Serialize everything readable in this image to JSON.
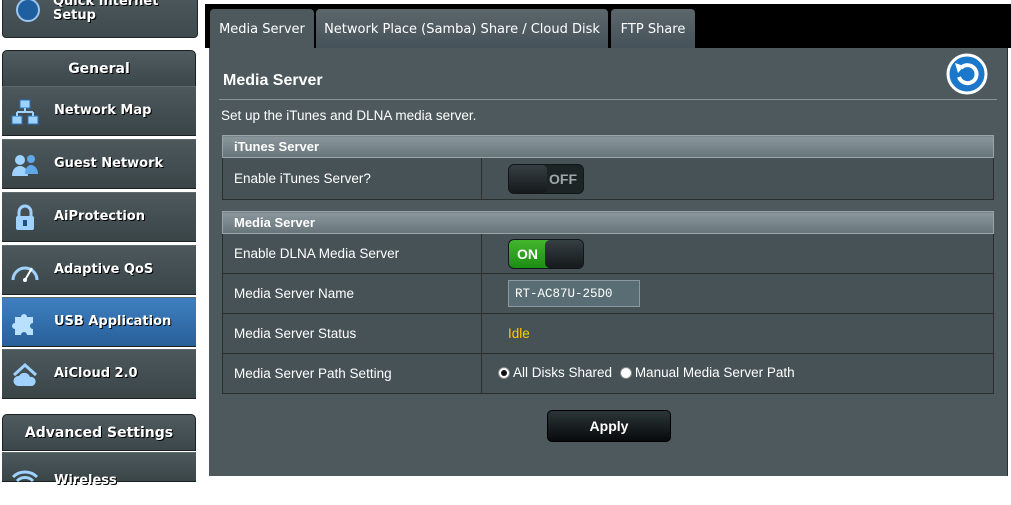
{
  "sidebar": {
    "quick_setup_line1": "Quick Internet",
    "quick_setup_line2": "Setup",
    "general_header": "General",
    "items": [
      {
        "label": "Network Map",
        "icon": "network-map-icon"
      },
      {
        "label": "Guest Network",
        "icon": "guest-network-icon"
      },
      {
        "label": "AiProtection",
        "icon": "lock-icon"
      },
      {
        "label": "Adaptive QoS",
        "icon": "speedometer-icon"
      },
      {
        "label": "USB Application",
        "icon": "puzzle-icon",
        "active": true
      },
      {
        "label": "AiCloud 2.0",
        "icon": "cloud-home-icon"
      }
    ],
    "advanced_header": "Advanced Settings",
    "partial_item": "Wireless"
  },
  "tabs": [
    {
      "label": "Media Server",
      "selected": true
    },
    {
      "label": "Network Place (Samba) Share / Cloud Disk"
    },
    {
      "label": "FTP Share"
    }
  ],
  "main": {
    "title": "Media Server",
    "description": "Set up the iTunes and DLNA media server.",
    "itunes_section": {
      "header": "iTunes Server",
      "enable_label": "Enable iTunes Server?",
      "enable_state": "OFF"
    },
    "media_section": {
      "header": "Media Server",
      "dlna_label": "Enable DLNA Media Server",
      "dlna_state": "ON",
      "name_label": "Media Server Name",
      "name_value": "RT-AC87U-25D0",
      "status_label": "Media Server Status",
      "status_value": "Idle",
      "path_label": "Media Server Path Setting",
      "path_option_all": "All Disks Shared",
      "path_option_manual": "Manual Media Server Path",
      "path_selected": "All Disks Shared"
    },
    "apply_label": "Apply"
  },
  "colors": {
    "panel_bg": "#4d595d",
    "accent_active": "#2f6fae",
    "status_yellow": "#ffcc00",
    "toggle_on_green": "#2aa51e"
  }
}
